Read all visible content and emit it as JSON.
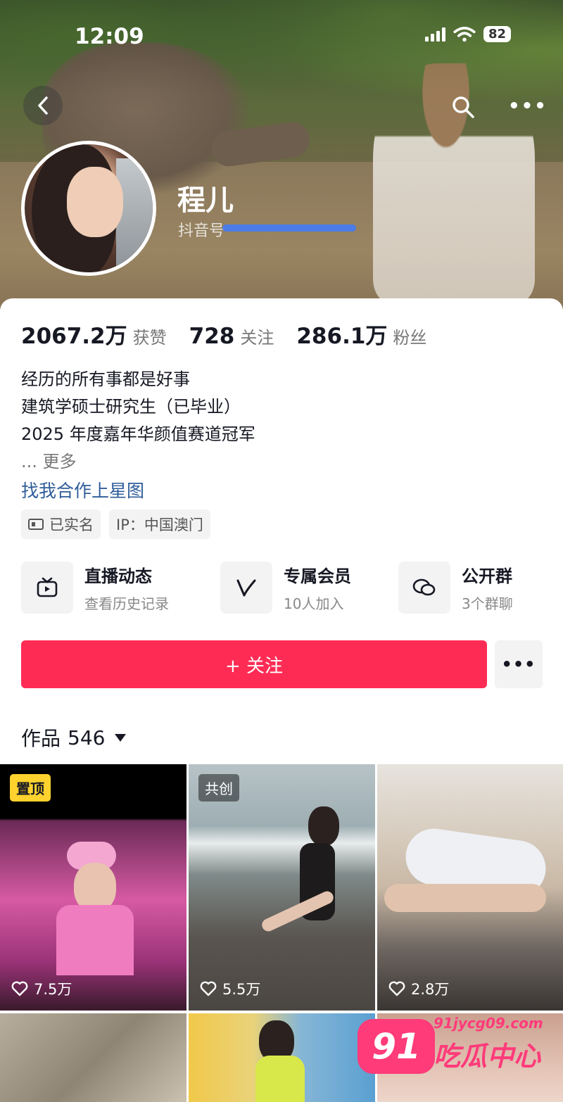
{
  "status_bar": {
    "time": "12:09",
    "battery": "82"
  },
  "profile": {
    "name": "程儿",
    "id_prefix": "抖音号",
    "stats": [
      {
        "value": "2067.2万",
        "label": "获赞"
      },
      {
        "value": "728",
        "label": "关注"
      },
      {
        "value": "286.1万",
        "label": "粉丝"
      }
    ],
    "bio_lines": [
      "经历的所有事都是好事",
      "建筑学硕士研究生（已毕业）",
      "2025 年度嘉年华颜值赛道冠军"
    ],
    "bio_more": "... 更多",
    "star_link": "找我合作上星图",
    "tags": [
      "已实名",
      "IP：中国澳门"
    ]
  },
  "features": [
    {
      "title": "直播动态",
      "sub": "查看历史记录",
      "icon": "tv-icon"
    },
    {
      "title": "专属会员",
      "sub": "10人加入",
      "icon": "v-icon"
    },
    {
      "title": "公开群",
      "sub": "3个群聊",
      "icon": "chat-icon"
    }
  ],
  "follow_label": "+ 关注",
  "works": {
    "label": "作品",
    "count": "546"
  },
  "tiles": [
    {
      "badge": "置顶",
      "likes": "7.5万"
    },
    {
      "badge": "共创",
      "likes": "5.5万"
    },
    {
      "badge": "",
      "likes": "2.8万"
    }
  ],
  "watermark": {
    "number": "91",
    "url": "91jycg09.com",
    "text": "吃瓜中心"
  },
  "colors": {
    "accent": "#fe2c55",
    "link": "#2f5d9a",
    "pin_badge": "#ffd22e"
  }
}
